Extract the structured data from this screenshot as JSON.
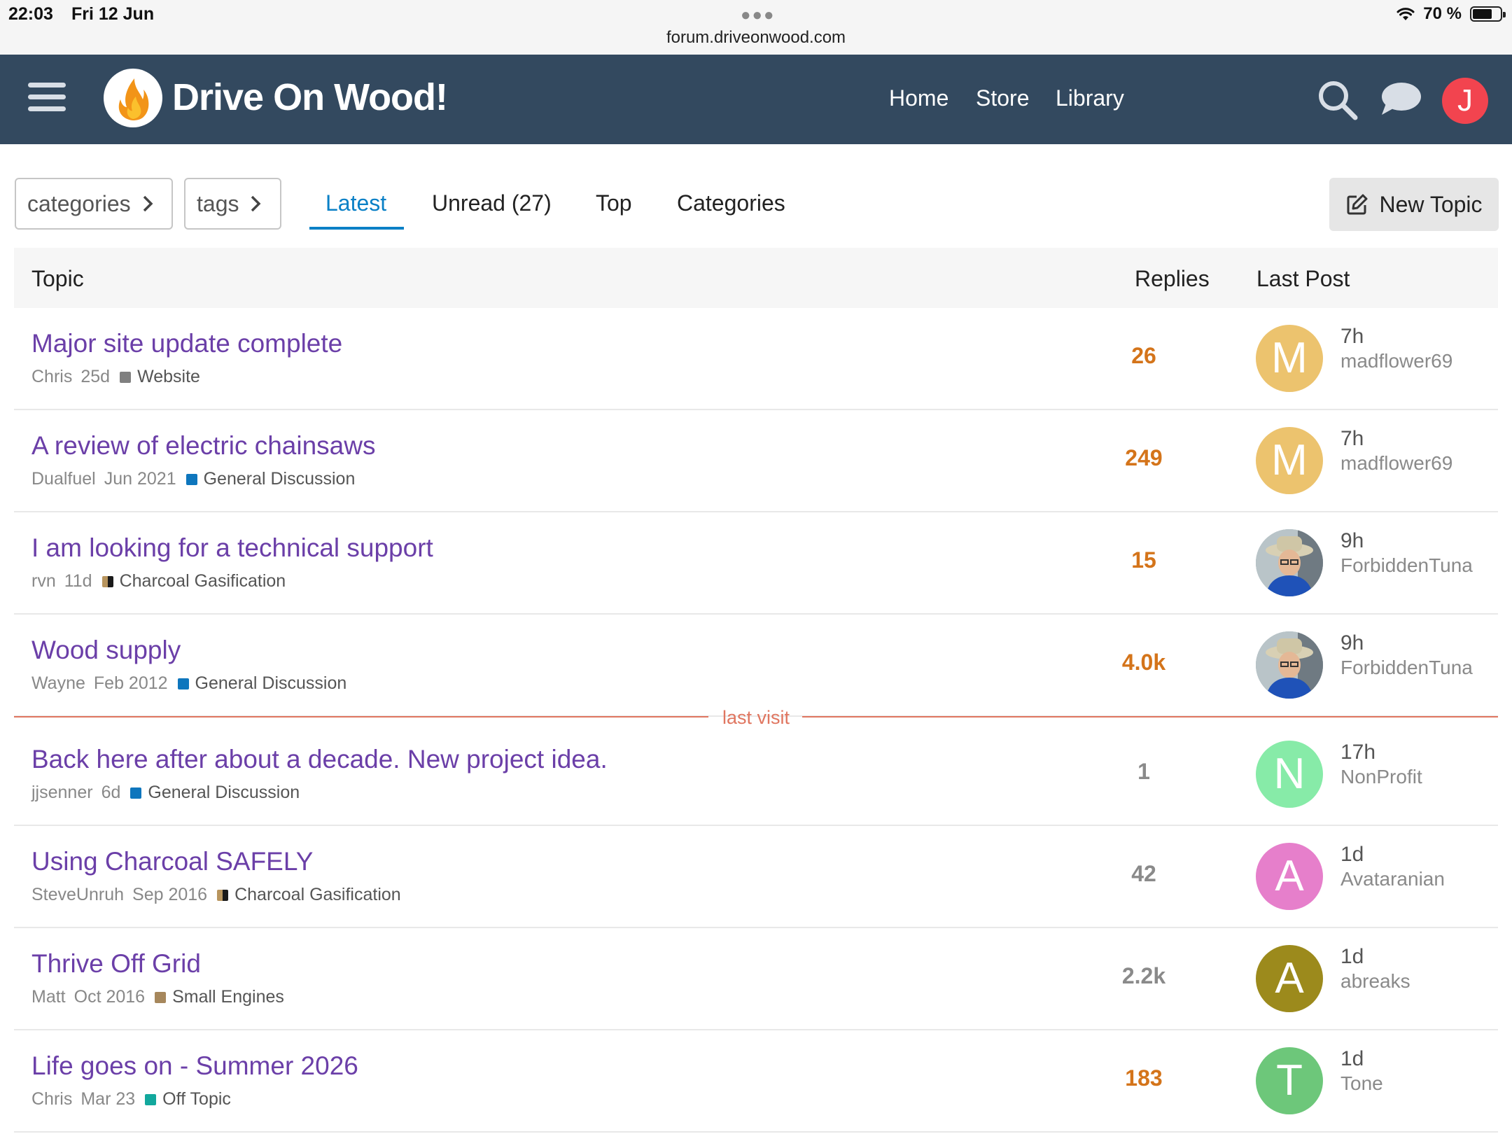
{
  "status_bar": {
    "time": "22:03",
    "date": "Fri 12 Jun",
    "url": "forum.driveonwood.com",
    "battery": "70 %",
    "battery_level": 0.7
  },
  "header": {
    "site_title": "Drive On Wood!",
    "nav": [
      "Home",
      "Store",
      "Library"
    ],
    "user_initial": "J",
    "icons": [
      "hamburger-menu-icon",
      "flame-logo-icon",
      "search-icon",
      "chat-bubble-icon"
    ]
  },
  "filters": {
    "categories_label": "categories",
    "tags_label": "tags"
  },
  "tabs": [
    "Latest",
    "Unread (27)",
    "Top",
    "Categories"
  ],
  "new_topic_label": "New Topic",
  "table": {
    "headers": {
      "topic": "Topic",
      "replies": "Replies",
      "last_post": "Last Post"
    },
    "last_visit_label": "last visit",
    "rows": [
      {
        "title": "Major site update complete",
        "author": "Chris",
        "age": "25d",
        "category": "Website",
        "category_color": "#808080",
        "replies": "26",
        "replies_hot": true,
        "avatar_letter": "M",
        "avatar_color": "#ecc36e",
        "last_post_time": "7h",
        "last_post_user": "madflower69"
      },
      {
        "title": "A review of electric chainsaws",
        "author": "Dualfuel",
        "age": "Jun 2021",
        "category": "General Discussion",
        "category_color": "#0e76bd",
        "replies": "249",
        "replies_hot": true,
        "avatar_letter": "M",
        "avatar_color": "#ecc36e",
        "last_post_time": "7h",
        "last_post_user": "madflower69"
      },
      {
        "title": "I am looking for a technical support",
        "author": "rvn",
        "age": "11d",
        "category": "Charcoal Gasification",
        "category_color": "#1a1a1a",
        "replies": "15",
        "replies_hot": true,
        "avatar_letter": "",
        "avatar_color": "#8aa0a8",
        "last_post_time": "9h",
        "last_post_user": "ForbiddenTuna"
      },
      {
        "title": "Wood supply",
        "author": "Wayne",
        "age": "Feb 2012",
        "category": "General Discussion",
        "category_color": "#0e76bd",
        "replies": "4.0k",
        "replies_hot": true,
        "avatar_letter": "",
        "avatar_color": "#8aa0a8",
        "last_post_time": "9h",
        "last_post_user": "ForbiddenTuna"
      },
      {
        "title": "Back here after about a decade. New project idea.",
        "author": "jjsenner",
        "age": "6d",
        "category": "General Discussion",
        "category_color": "#0e76bd",
        "replies": "1",
        "replies_hot": false,
        "avatar_letter": "N",
        "avatar_color": "#87eba8",
        "last_post_time": "17h",
        "last_post_user": "NonProfit"
      },
      {
        "title": "Using Charcoal SAFELY",
        "author": "SteveUnruh",
        "age": "Sep 2016",
        "category": "Charcoal Gasification",
        "category_color": "#1a1a1a",
        "replies": "42",
        "replies_hot": false,
        "avatar_letter": "A",
        "avatar_color": "#e67fcb",
        "last_post_time": "1d",
        "last_post_user": "Avataranian"
      },
      {
        "title": "Thrive Off Grid",
        "author": "Matt",
        "age": "Oct 2016",
        "category": "Small Engines",
        "category_color": "#a6875c",
        "replies": "2.2k",
        "replies_hot": false,
        "avatar_letter": "A",
        "avatar_color": "#9c8a1c",
        "last_post_time": "1d",
        "last_post_user": "abreaks"
      },
      {
        "title": "Life goes on - Summer 2026",
        "author": "Chris",
        "age": "Mar 23",
        "category": "Off Topic",
        "category_color": "#12a89d",
        "replies": "183",
        "replies_hot": true,
        "avatar_letter": "T",
        "avatar_color": "#6dc77a",
        "last_post_time": "1d",
        "last_post_user": "Tone"
      }
    ]
  }
}
